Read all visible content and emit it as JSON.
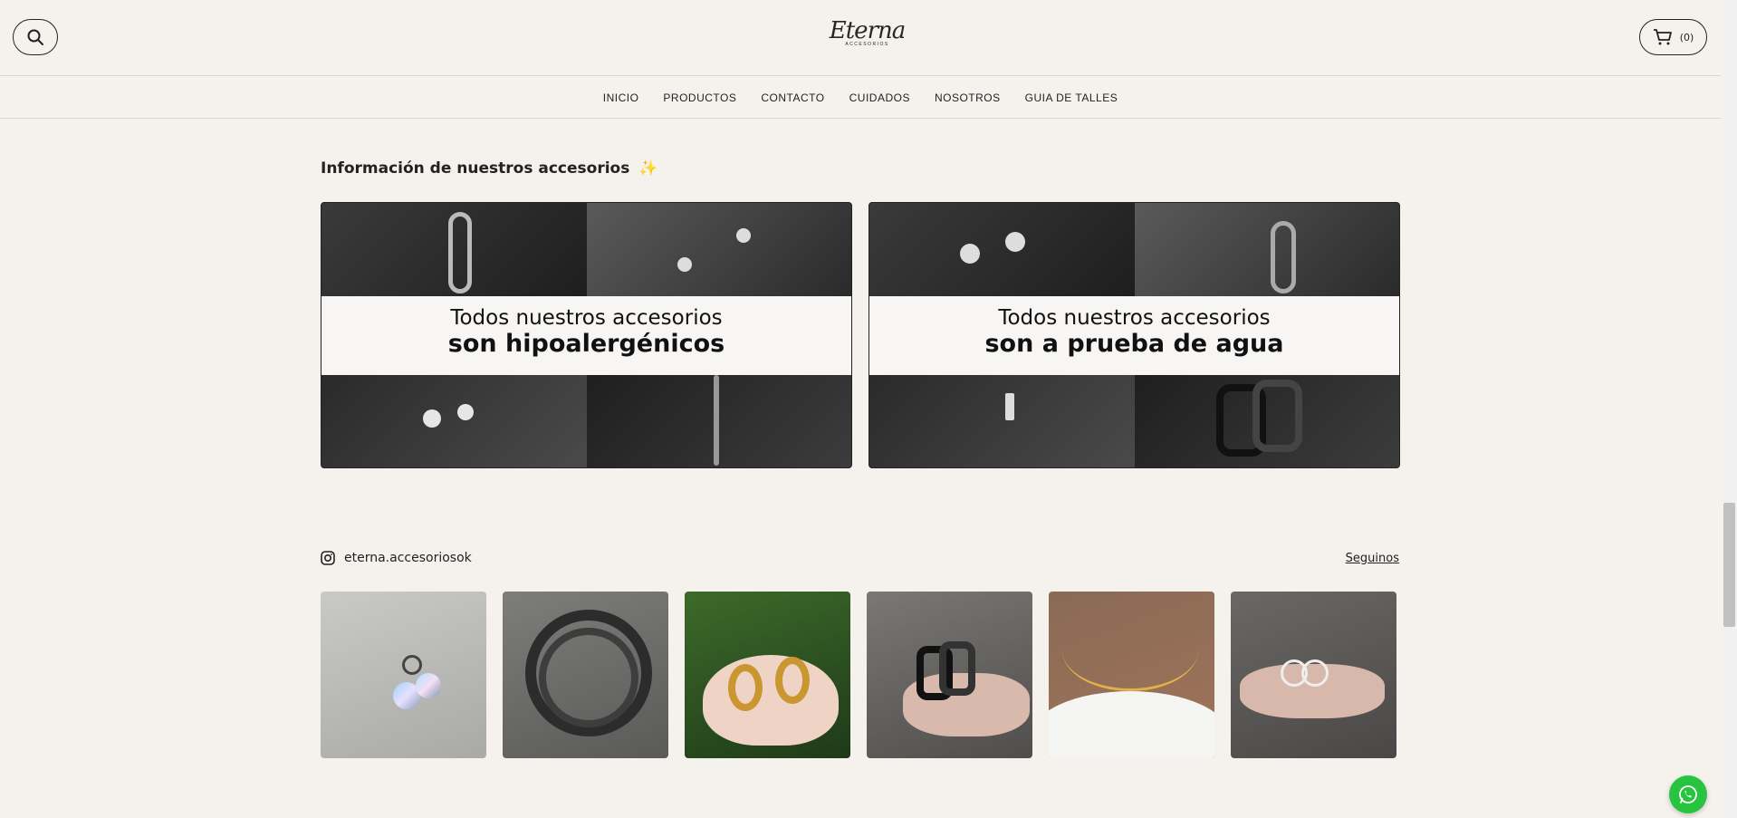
{
  "header": {
    "logo_text": "Eterna",
    "logo_sub": "ACCESORIOS",
    "cart_count": "(0)"
  },
  "nav": {
    "items": [
      "INICIO",
      "PRODUCTOS",
      "CONTACTO",
      "CUIDADOS",
      "NOSOTROS",
      "GUIA DE TALLES"
    ]
  },
  "info": {
    "title": "Información de nuestros accesorios",
    "emoji": "✨",
    "banners": [
      {
        "line1": "Todos nuestros accesorios",
        "line2": "son hipoalergénicos"
      },
      {
        "line1": "Todos nuestros accesorios",
        "line2": "son a prueba de agua"
      }
    ]
  },
  "instagram": {
    "handle": "eterna.accesoriosok",
    "follow_label": "Seguinos",
    "icon": "instagram-icon"
  },
  "icons": {
    "search": "search-icon",
    "cart": "cart-icon",
    "whatsapp": "whatsapp-icon"
  },
  "colors": {
    "background": "#f5f2ee",
    "whatsapp": "#26c43f"
  }
}
